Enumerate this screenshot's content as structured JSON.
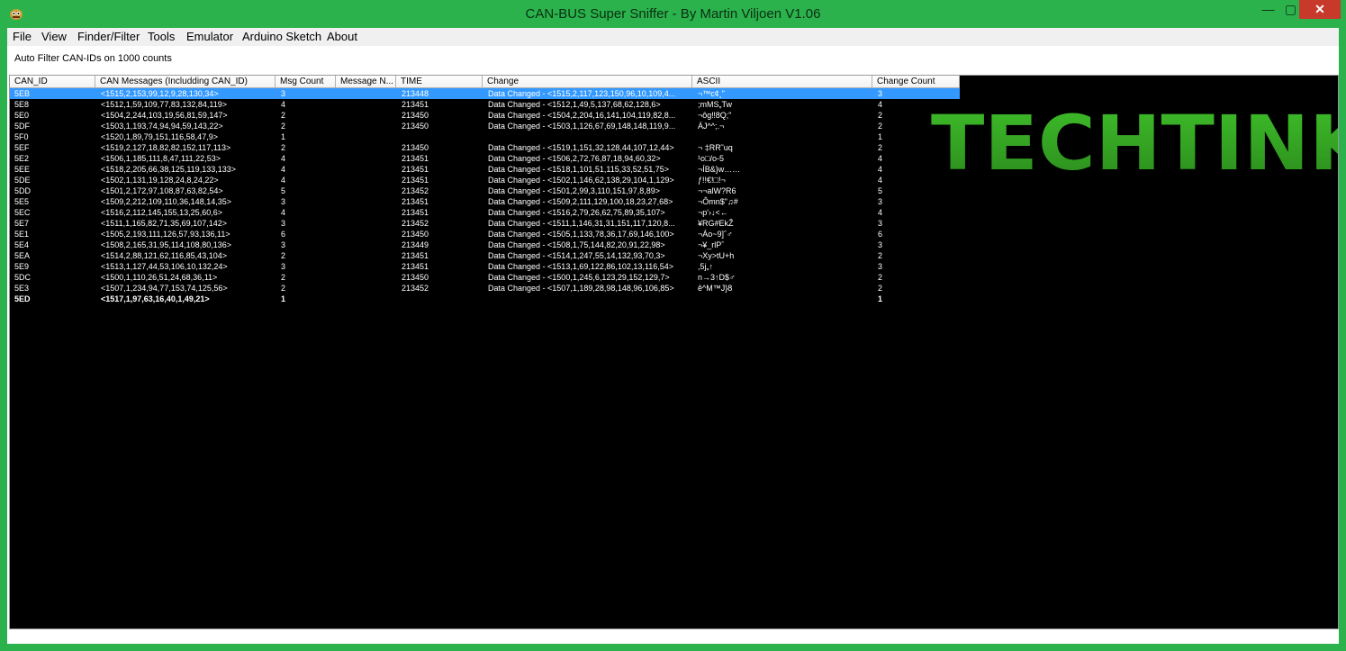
{
  "window": {
    "title": "CAN-BUS Super Sniffer - By Martin Viljoen V1.06",
    "controls": {
      "minimize": "—",
      "maximize": "▢",
      "close": "✕"
    }
  },
  "menu": [
    "File",
    "View",
    "Finder/Filter",
    "Tools",
    "Emulator",
    "Arduino Sketch",
    "About"
  ],
  "status_text": "Auto Filter CAN-IDs on 1000 counts",
  "logo_text": "TECHTINKI",
  "columns": [
    "CAN_ID",
    "CAN Messages (Includding CAN_ID)",
    "Msg Count",
    "Message N...",
    "TIME",
    "Change",
    "ASCII",
    "Change Count"
  ],
  "rows": [
    {
      "id": "5EB",
      "msg": "<1515,2,153,99,12,9,28,130,34>",
      "count": "3",
      "time": "213448",
      "change": "Data Changed - <1515,2,117,123,150,96,10,109,4...",
      "ascii": "¬™c¢¸\"",
      "cc": "3"
    },
    {
      "id": "5E8",
      "msg": "<1512,1,59,109,77,83,132,84,119>",
      "count": "4",
      "time": "213451",
      "change": "Data Changed - <1512,1,49,5,137,68,62,128,6>",
      "ascii": ";mMS„Tw",
      "cc": "4"
    },
    {
      "id": "5E0",
      "msg": "<1504,2,244,103,19,56,81,59,147>",
      "count": "2",
      "time": "213450",
      "change": "Data Changed - <1504,2,204,16,141,104,119,82,8...",
      "ascii": "¬ôg‼8Q;\"",
      "cc": "2"
    },
    {
      "id": "5DF",
      "msg": "<1503,1,193,74,94,94,59,143,22>",
      "count": "2",
      "time": "213450",
      "change": "Data Changed - <1503,1,126,67,69,148,148,119,9...",
      "ascii": "ÁJ^^;.¬",
      "cc": "2"
    },
    {
      "id": "5F0",
      "msg": "<1520,1,89,79,151,116,58,47,9>",
      "count": "1",
      "time": "",
      "change": "",
      "ascii": "",
      "cc": "1"
    },
    {
      "id": "5EF",
      "msg": "<1519,2,127,18,82,82,152,117,113>",
      "count": "2",
      "time": "213450",
      "change": "Data Changed - <1519,1,151,32,128,44,107,12,44>",
      "ascii": "¬ ‡RR˜uq",
      "cc": "2"
    },
    {
      "id": "5E2",
      "msg": "<1506,1,185,111,8,47,111,22,53>",
      "count": "4",
      "time": "213451",
      "change": "Data Changed - <1506,2,72,76,87,18,94,60,32>",
      "ascii": "¹o□/o-5",
      "cc": "4"
    },
    {
      "id": "5EE",
      "msg": "<1518,2,205,66,38,125,119,133,133>",
      "count": "4",
      "time": "213451",
      "change": "Data Changed - <1518,1,101,51,115,33,52,51,75>",
      "ascii": "¬ÍB&}w……",
      "cc": "4"
    },
    {
      "id": "5DE",
      "msg": "<1502,1,131,19,128,24,8,24,22>",
      "count": "4",
      "time": "213451",
      "change": "Data Changed - <1502,1,146,62,138,29,104,1,129>",
      "ascii": "ƒ!!€!□!¬",
      "cc": "4"
    },
    {
      "id": "5DD",
      "msg": "<1501,2,172,97,108,87,63,82,54>",
      "count": "5",
      "time": "213452",
      "change": "Data Changed - <1501,2,99,3,110,151,97,8,89>",
      "ascii": "¬¬alW?R6",
      "cc": "5"
    },
    {
      "id": "5E5",
      "msg": "<1509,2,212,109,110,36,148,14,35>",
      "count": "3",
      "time": "213451",
      "change": "Data Changed - <1509,2,111,129,100,18,23,27,68>",
      "ascii": "¬Ômn$\"♫#",
      "cc": "3"
    },
    {
      "id": "5EC",
      "msg": "<1516,2,112,145,155,13,25,60,6>",
      "count": "4",
      "time": "213451",
      "change": "Data Changed - <1516,2,79,26,62,75,89,35,107>",
      "ascii": "¬p'›↓<←",
      "cc": "4"
    },
    {
      "id": "5E7",
      "msg": "<1511,1,165,82,71,35,69,107,142>",
      "count": "3",
      "time": "213452",
      "change": "Data Changed - <1511,1,146,31,31,151,117,120,8...",
      "ascii": "¥RG#EkŽ",
      "cc": "3"
    },
    {
      "id": "5E1",
      "msg": "<1505,2,193,111,126,57,93,136,11>",
      "count": "6",
      "time": "213450",
      "change": "Data Changed - <1505,1,133,78,36,17,69,146,100>",
      "ascii": "¬Áo~9]ˆ♂",
      "cc": "6"
    },
    {
      "id": "5E4",
      "msg": "<1508,2,165,31,95,114,108,80,136>",
      "count": "3",
      "time": "213449",
      "change": "Data Changed - <1508,1,75,144,82,20,91,22,98>",
      "ascii": "¬¥_rlPˆ",
      "cc": "3"
    },
    {
      "id": "5EA",
      "msg": "<1514,2,88,121,62,116,85,43,104>",
      "count": "2",
      "time": "213451",
      "change": "Data Changed - <1514,1,247,55,14,132,93,70,3>",
      "ascii": "¬Xy>tU+h",
      "cc": "2"
    },
    {
      "id": "5E9",
      "msg": "<1513,1,127,44,53,106,10,132,24>",
      "count": "3",
      "time": "213451",
      "change": "Data Changed - <1513,1,69,122,86,102,13,116,54>",
      "ascii": ",5j„↑",
      "cc": "3"
    },
    {
      "id": "5DC",
      "msg": "<1500,1,110,26,51,24,68,36,11>",
      "count": "2",
      "time": "213450",
      "change": "Data Changed - <1500,1,245,6,123,29,152,129,7>",
      "ascii": "n→3↑D$♂",
      "cc": "2"
    },
    {
      "id": "5E3",
      "msg": "<1507,1,234,94,77,153,74,125,56>",
      "count": "2",
      "time": "213452",
      "change": "Data Changed - <1507,1,189,28,98,148,96,106,85>",
      "ascii": "ê^M™J}8",
      "cc": "2"
    },
    {
      "id": "5ED",
      "msg": "<1517,1,97,63,16,40,1,49,21>",
      "count": "1",
      "time": "",
      "change": "",
      "ascii": "",
      "cc": "1"
    }
  ],
  "selected_row": 0,
  "bold_row": 19
}
